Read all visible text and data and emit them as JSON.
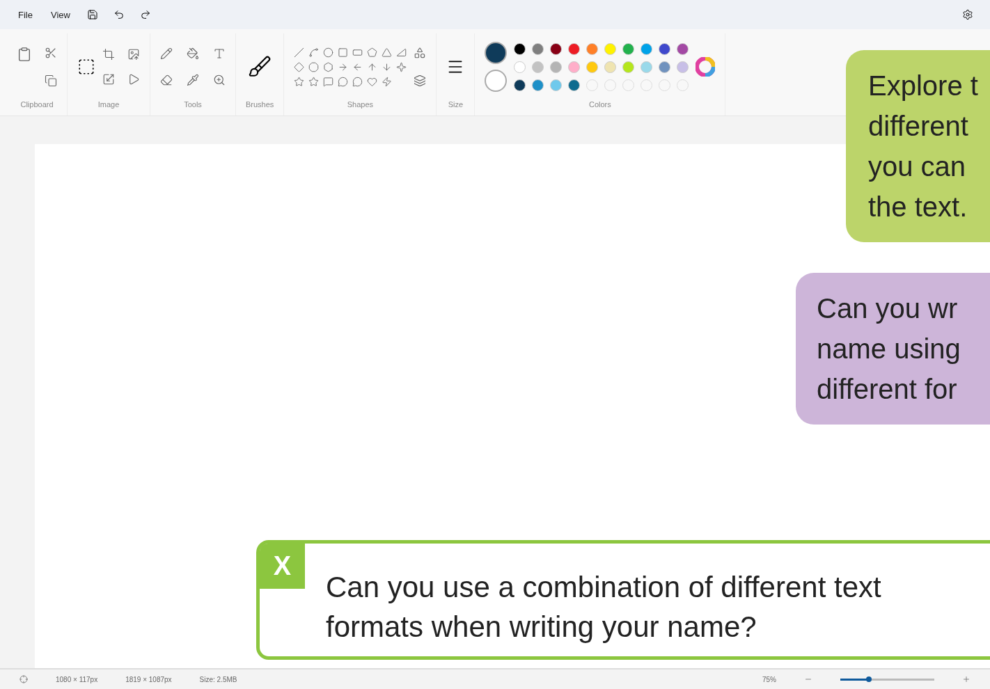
{
  "menu": [
    {
      "label": "File"
    },
    {
      "label": "View"
    }
  ],
  "ribbon_groups": [
    {
      "label": "Clipboard",
      "kind": "clipboard"
    },
    {
      "label": "Image",
      "kind": "image"
    },
    {
      "label": "Tools",
      "kind": "tools"
    },
    {
      "label": "Brushes",
      "kind": "brushes"
    },
    {
      "label": "Shapes",
      "kind": "shapes"
    },
    {
      "label": "Size",
      "kind": "size"
    },
    {
      "label": "Colors",
      "kind": "colors"
    }
  ],
  "colors": {
    "primary": {
      "color": "#0f3b5a"
    },
    "secondary": {
      "color": "#ffffff"
    },
    "palette": [
      {
        "kind": "swatch",
        "color": "#000000"
      },
      {
        "kind": "swatch",
        "color": "#7f7f7f"
      },
      {
        "kind": "swatch",
        "color": "#880015"
      },
      {
        "kind": "swatch",
        "color": "#ed1c24"
      },
      {
        "kind": "swatch",
        "color": "#ff7f27"
      },
      {
        "kind": "swatch",
        "color": "#fff200"
      },
      {
        "kind": "swatch",
        "color": "#22b14c"
      },
      {
        "kind": "swatch",
        "color": "#00a2e8"
      },
      {
        "kind": "swatch",
        "color": "#3f48cc"
      },
      {
        "kind": "swatch",
        "color": "#a349a4"
      },
      {
        "kind": "swatch",
        "color": "#ffffff"
      },
      {
        "kind": "swatch",
        "color": "#c3c3c3"
      },
      {
        "kind": "swatch",
        "color": "#b4b4b4"
      },
      {
        "kind": "swatch",
        "color": "#ffaec9"
      },
      {
        "kind": "swatch",
        "color": "#ffc90e"
      },
      {
        "kind": "swatch",
        "color": "#efe4b0"
      },
      {
        "kind": "swatch",
        "color": "#b5e61d"
      },
      {
        "kind": "swatch",
        "color": "#99d9ea"
      },
      {
        "kind": "swatch",
        "color": "#7092be"
      },
      {
        "kind": "swatch",
        "color": "#c8bfe7"
      },
      {
        "kind": "swatch",
        "color": "#0f3b5a"
      },
      {
        "kind": "swatch",
        "color": "#1e90c8"
      },
      {
        "kind": "swatch",
        "color": "#6fc9ec"
      },
      {
        "kind": "swatch",
        "color": "#0e6b8f"
      },
      {
        "kind": "empty"
      },
      {
        "kind": "empty"
      },
      {
        "kind": "empty"
      },
      {
        "kind": "empty"
      },
      {
        "kind": "empty"
      },
      {
        "kind": "empty"
      }
    ]
  },
  "callouts": [
    {
      "color": "#bcd46a",
      "lines": [
        "Explore t",
        "different",
        "you can",
        "the text."
      ]
    },
    {
      "color": "#cdb5d9",
      "lines": [
        "Can you wr",
        "name using",
        "different for"
      ]
    }
  ],
  "task": {
    "badge": "X",
    "text": "Can you use a combination of different text formats when writing your name?"
  },
  "status_bar": {
    "selection": "1080 × 117px",
    "canvas_size": "1819 × 1087px",
    "file_size": "Size: 2.5MB",
    "zoom": "75%",
    "zoom_slider": {
      "level": 0.3
    }
  }
}
